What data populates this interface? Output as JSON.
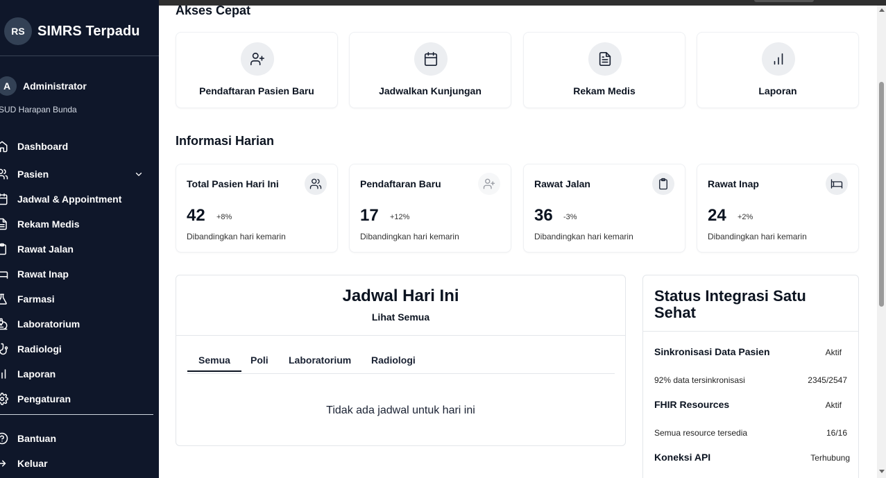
{
  "sidebar": {
    "logo_initials": "RS",
    "app_name": "SIMRS Terpadu",
    "user": {
      "initial": "A",
      "name": "Administrator",
      "org": "SUD Harapan Bunda"
    },
    "items": [
      {
        "label": "Dashboard",
        "icon": "home-icon"
      },
      {
        "label": "Pasien",
        "icon": "users-icon"
      },
      {
        "label": "Jadwal & Appointment",
        "icon": "calendar-icon"
      },
      {
        "label": "Rekam Medis",
        "icon": "file-text-icon"
      },
      {
        "label": "Rawat Jalan",
        "icon": "clipboard-icon"
      },
      {
        "label": "Rawat Inap",
        "icon": "bed-icon"
      },
      {
        "label": "Farmasi",
        "icon": "flask-icon"
      },
      {
        "label": "Laboratorium",
        "icon": "microscope-icon"
      },
      {
        "label": "Radiologi",
        "icon": "stethoscope-icon"
      },
      {
        "label": "Laporan",
        "icon": "bar-chart-icon"
      },
      {
        "label": "Pengaturan",
        "icon": "gear-icon"
      }
    ],
    "footer_items": [
      {
        "label": "Bantuan",
        "icon": "help-circle-icon"
      },
      {
        "label": "Keluar",
        "icon": "logout-icon"
      }
    ]
  },
  "quick_access": {
    "title": "Akses Cepat",
    "items": [
      {
        "label": "Pendaftaran Pasien Baru",
        "icon": "user-plus-icon"
      },
      {
        "label": "Jadwalkan Kunjungan",
        "icon": "calendar-icon"
      },
      {
        "label": "Rekam Medis",
        "icon": "file-text-icon"
      },
      {
        "label": "Laporan",
        "icon": "bar-chart-icon"
      }
    ]
  },
  "daily_info": {
    "title": "Informasi Harian",
    "cards": [
      {
        "title": "Total Pasien Hari Ini",
        "value": "42",
        "change": "+8%",
        "subtitle": "Dibandingkan hari kemarin",
        "icon": "users-icon"
      },
      {
        "title": "Pendaftaran Baru",
        "value": "17",
        "change": "+12%",
        "subtitle": "Dibandingkan hari kemarin",
        "icon": "user-plus-icon"
      },
      {
        "title": "Rawat Jalan",
        "value": "36",
        "change": "-3%",
        "subtitle": "Dibandingkan hari kemarin",
        "icon": "clipboard-icon"
      },
      {
        "title": "Rawat Inap",
        "value": "24",
        "change": "+2%",
        "subtitle": "Dibandingkan hari kemarin",
        "icon": "bed-icon"
      }
    ]
  },
  "schedule": {
    "title": "Jadwal Hari Ini",
    "link": "Lihat Semua",
    "tabs": [
      "Semua",
      "Poli",
      "Laboratorium",
      "Radiologi"
    ],
    "active_tab": "Semua",
    "empty_text": "Tidak ada jadwal untuk hari ini"
  },
  "integration": {
    "title": "Status Integrasi Satu Sehat",
    "rows": [
      {
        "name": "Sinkronisasi Data Pasien",
        "status": "Aktif",
        "detail": "92% data tersinkronisasi",
        "count": "2345/2547"
      },
      {
        "name": "FHIR Resources",
        "status": "Aktif",
        "detail": "Semua resource tersedia",
        "count": "16/16"
      },
      {
        "name": "Koneksi API",
        "status": "Terhubung"
      }
    ]
  }
}
